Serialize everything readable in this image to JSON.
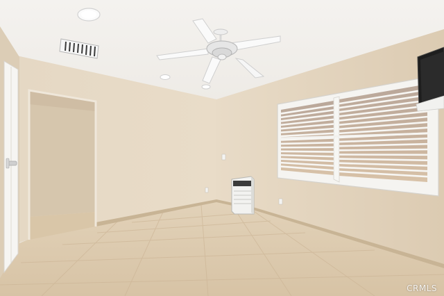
{
  "scene": {
    "description_colors": {
      "ceiling": "#f3f1ee",
      "wall_left": "#e3d6c2",
      "wall_back": "#e6d9c5",
      "wall_right": "#e2d3bc",
      "floor": "#dcc9ad",
      "baseboard": "#cdb99b",
      "trim_white": "#f7f7f5",
      "shutter": "#f4f3f0"
    },
    "icons": [
      "ceiling-fan-icon",
      "recessed-light-icon",
      "air-vent-icon",
      "wall-heater-icon",
      "tv-icon",
      "door-handle-icon"
    ]
  },
  "watermark": {
    "text": "CRMLS"
  }
}
